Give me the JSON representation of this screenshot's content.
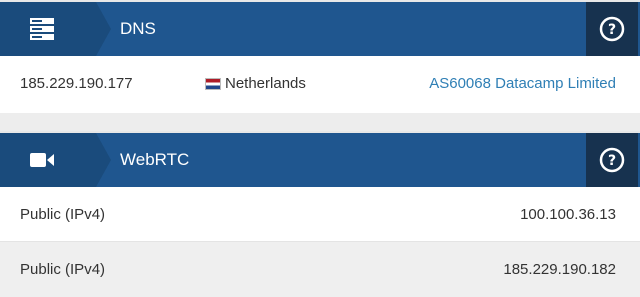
{
  "dns": {
    "title": "DNS",
    "icon": "server-icon",
    "help": "?",
    "ip": "185.229.190.177",
    "country": "Netherlands",
    "isp": "AS60068 Datacamp Limited"
  },
  "webrtc": {
    "title": "WebRTC",
    "icon": "video-camera-icon",
    "help": "?",
    "rows": [
      {
        "label": "Public (IPv4)",
        "value": "100.100.36.13"
      },
      {
        "label": "Public (IPv4)",
        "value": "185.229.190.182"
      }
    ]
  },
  "colors": {
    "header": "#1f568f",
    "icon_box": "#1a4b7c",
    "help_box": "#17324f",
    "link": "#2f7fb5"
  }
}
